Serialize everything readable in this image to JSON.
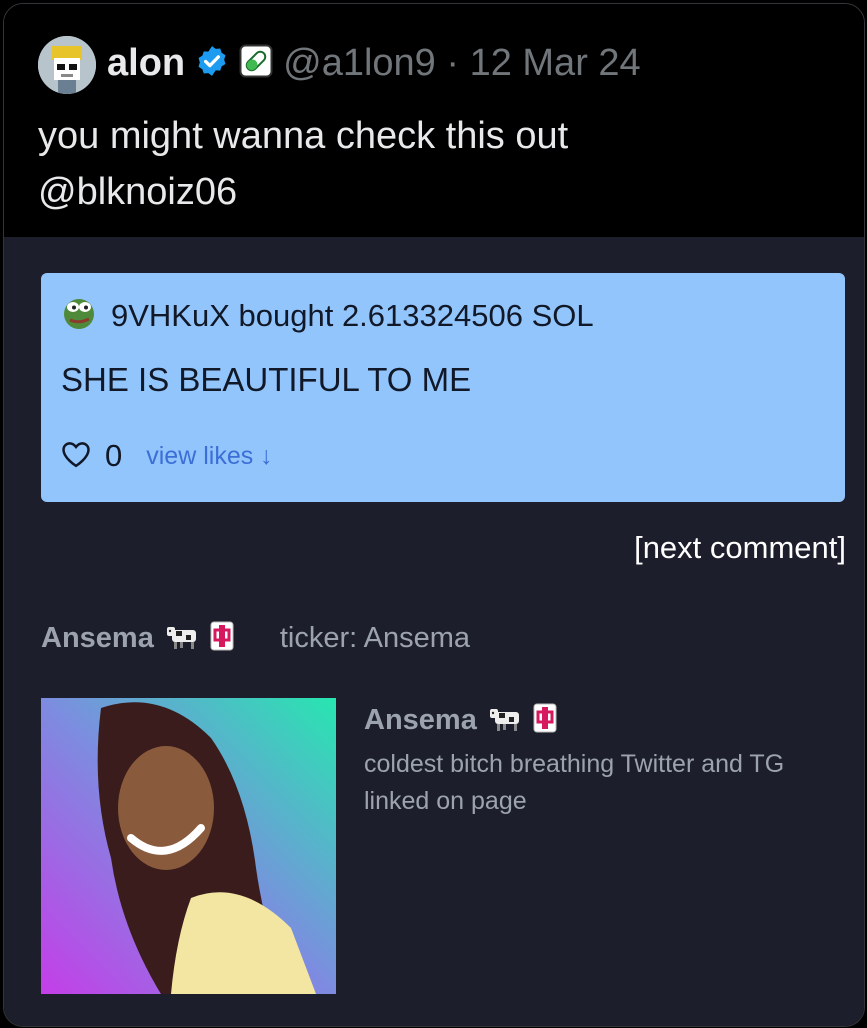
{
  "tweet": {
    "author_name": "alon",
    "handle_meta": "@a1lon9 · 12 Mar 24",
    "text_lines": [
      "you might wanna check this out",
      "@blknoiz06"
    ]
  },
  "comment": {
    "buyer_line": "9VHKuX bought 2.613324506 SOL",
    "text": "SHE IS BEAUTIFUL TO ME",
    "like_count": "0",
    "view_likes_label": "view likes ↓"
  },
  "next_comment_label": "[next comment]",
  "token": {
    "name": "Ansema",
    "ticker": "ticker: Ansema",
    "description": "coldest bitch breathing Twitter and TG linked on page"
  },
  "colors": {
    "verified": "#1d9bf0",
    "comment_bg": "#93c5fd",
    "embed_bg": "#1c1f2b"
  },
  "icons": [
    "avatar",
    "verified-badge-icon",
    "pill-icon",
    "pepe-avatar",
    "heart-icon",
    "cow-emoji-icon",
    "mahjong-tile-icon"
  ]
}
